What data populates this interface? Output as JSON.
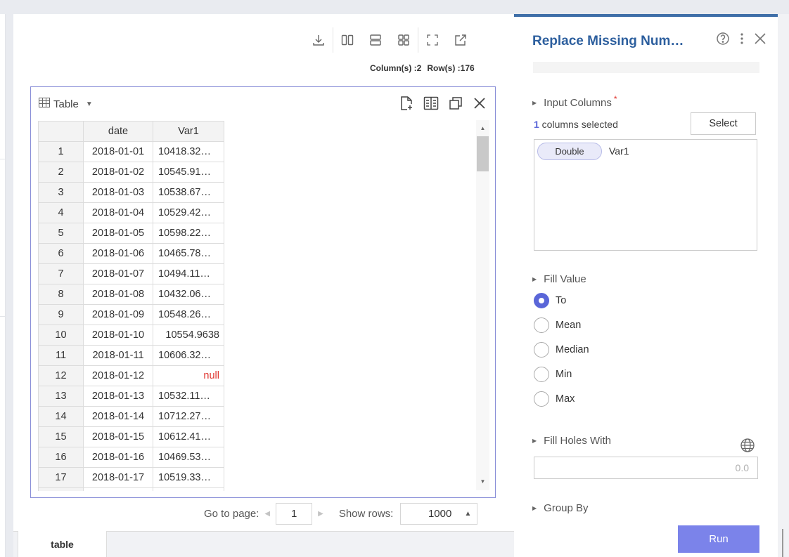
{
  "toolbar": {
    "counts": {
      "columns": "Column(s) :2",
      "rows": "Row(s) :176"
    },
    "icons": [
      "download-icon",
      "split-vertical-icon",
      "split-horizontal-icon",
      "grid-view-icon",
      "fullscreen-icon",
      "open-external-icon"
    ]
  },
  "table_panel": {
    "title": "Table",
    "columns": [
      "date",
      "Var1"
    ],
    "rows": [
      {
        "idx": "1",
        "date": "2018-01-01",
        "val": "10418.32…",
        "kind": "text"
      },
      {
        "idx": "2",
        "date": "2018-01-02",
        "val": "10545.91…",
        "kind": "text"
      },
      {
        "idx": "3",
        "date": "2018-01-03",
        "val": "10538.67…",
        "kind": "text"
      },
      {
        "idx": "4",
        "date": "2018-01-04",
        "val": "10529.42…",
        "kind": "text"
      },
      {
        "idx": "5",
        "date": "2018-01-05",
        "val": "10598.22…",
        "kind": "text"
      },
      {
        "idx": "6",
        "date": "2018-01-06",
        "val": "10465.78…",
        "kind": "text"
      },
      {
        "idx": "7",
        "date": "2018-01-07",
        "val": "10494.11…",
        "kind": "text"
      },
      {
        "idx": "8",
        "date": "2018-01-08",
        "val": "10432.06…",
        "kind": "text"
      },
      {
        "idx": "9",
        "date": "2018-01-09",
        "val": "10548.26…",
        "kind": "text"
      },
      {
        "idx": "10",
        "date": "2018-01-10",
        "val": "10554.9638",
        "kind": "num"
      },
      {
        "idx": "11",
        "date": "2018-01-11",
        "val": "10606.32…",
        "kind": "text"
      },
      {
        "idx": "12",
        "date": "2018-01-12",
        "val": "null",
        "kind": "null"
      },
      {
        "idx": "13",
        "date": "2018-01-13",
        "val": "10532.11…",
        "kind": "text"
      },
      {
        "idx": "14",
        "date": "2018-01-14",
        "val": "10712.27…",
        "kind": "text"
      },
      {
        "idx": "15",
        "date": "2018-01-15",
        "val": "10612.41…",
        "kind": "text"
      },
      {
        "idx": "16",
        "date": "2018-01-16",
        "val": "10469.53…",
        "kind": "text"
      },
      {
        "idx": "17",
        "date": "2018-01-17",
        "val": "10519.33…",
        "kind": "text"
      }
    ]
  },
  "pager": {
    "goto_label": "Go to page:",
    "page": "1",
    "show_rows_label": "Show rows:",
    "rows_value": "1000"
  },
  "bottom_tab": {
    "label": "table"
  },
  "side_panel": {
    "title": "Replace Missing Num…",
    "input_columns": {
      "label": "Input Columns",
      "required_mark": "*",
      "selected_count": "1",
      "selected_suffix": " columns selected",
      "select_button": "Select",
      "chip_type": "Double",
      "chip_column": "Var1"
    },
    "fill_value": {
      "label": "Fill Value",
      "options": [
        {
          "label": "To",
          "selected": true
        },
        {
          "label": "Mean",
          "selected": false
        },
        {
          "label": "Median",
          "selected": false
        },
        {
          "label": "Min",
          "selected": false
        },
        {
          "label": "Max",
          "selected": false
        }
      ]
    },
    "fill_holes": {
      "label": "Fill Holes With",
      "placeholder": "0.0"
    },
    "group_by": {
      "label": "Group By"
    },
    "run_button": "Run"
  },
  "colors": {
    "accent": "#5a66d8",
    "title_blue": "#2d5f9e",
    "run_button": "#7b83ea",
    "null_text": "#e0352f",
    "panel_border": "#8a8fd8"
  }
}
